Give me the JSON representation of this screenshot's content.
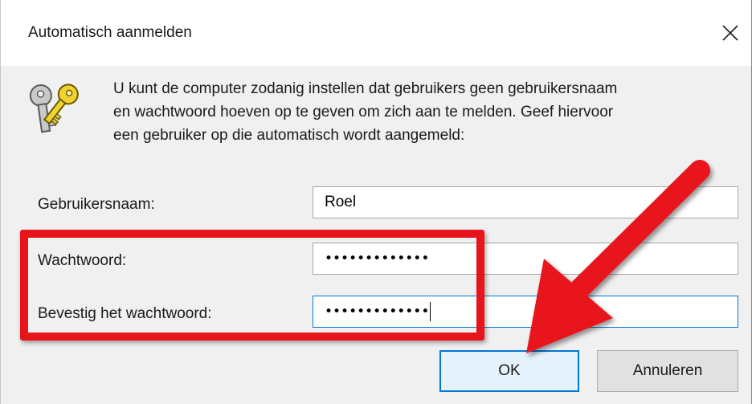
{
  "window": {
    "title": "Automatisch aanmelden",
    "close_glyph": "✕"
  },
  "icons": {
    "header": "keys-icon",
    "close": "close-icon"
  },
  "description": {
    "line1": "U kunt de computer zodanig instellen dat gebruikers geen gebruikersnaam",
    "line2": "en wachtwoord hoeven op te geven om zich aan te melden. Geef hiervoor",
    "line3": "een gebruiker op die automatisch wordt aangemeld:"
  },
  "form": {
    "username_label": "Gebruikersnaam:",
    "username_value": "Roel",
    "password_label": "Wachtwoord:",
    "password_value": "•••••••••••••",
    "confirm_label": "Bevestig het wachtwoord:",
    "confirm_value": "•••••••••••••"
  },
  "buttons": {
    "ok_label": "OK",
    "cancel_label": "Annuleren"
  },
  "colors": {
    "annotation_red": "#e8141c",
    "focus_blue": "#0078d7",
    "dialog_bg": "#f0f0f0"
  }
}
